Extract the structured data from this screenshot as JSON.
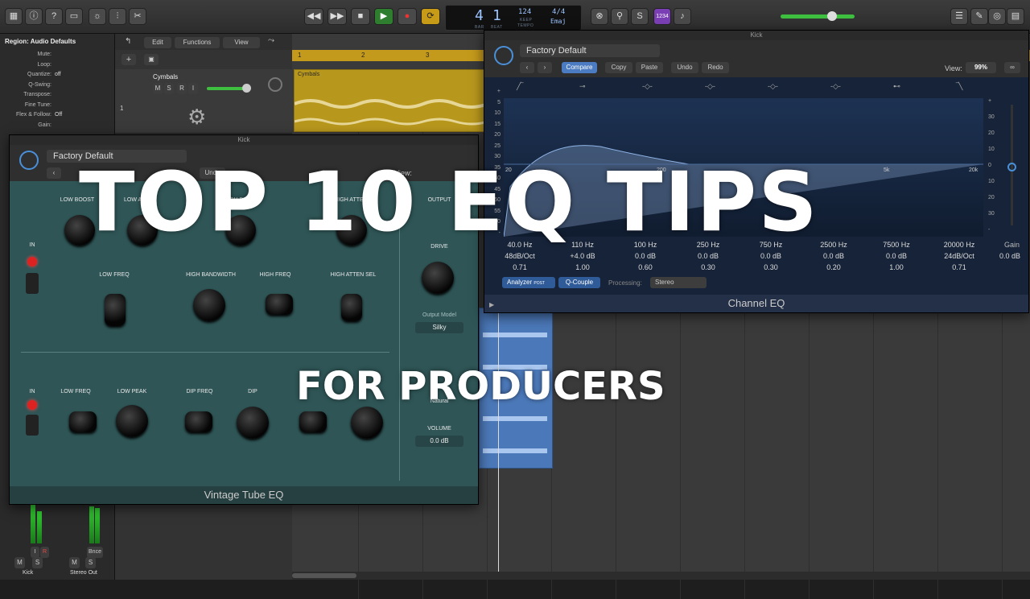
{
  "transport": {
    "bar": "4",
    "beat": "1",
    "bar_caption": "BAR",
    "beat_caption": "BEAT",
    "tempo": "124",
    "tempo_caption": "KEEP",
    "tempo_sub": "TEMPO",
    "signature": "4/4",
    "key": "Emaj",
    "count_in": "1234"
  },
  "inspector": {
    "region_title": "Region: Audio Defaults",
    "rows": [
      {
        "label": "Mute:",
        "value": ""
      },
      {
        "label": "Loop:",
        "value": ""
      },
      {
        "label": "Quantize:",
        "value": "off"
      },
      {
        "label": "Q-Swing:",
        "value": ""
      },
      {
        "label": "Transpose:",
        "value": ""
      },
      {
        "label": "Fine Tune:",
        "value": ""
      },
      {
        "label": "Flex & Follow:",
        "value": "Off"
      },
      {
        "label": "Gain:",
        "value": ""
      }
    ]
  },
  "edit_menu": {
    "edit": "Edit",
    "functions": "Functions",
    "view": "View"
  },
  "ruler": [
    "1",
    "2",
    "3"
  ],
  "track": {
    "name": "Cymbals",
    "number": "1",
    "m": "M",
    "s": "S",
    "r": "R",
    "i": "I",
    "region": "Cymbals"
  },
  "mixer": {
    "strip1": {
      "name": "Kick",
      "m": "M",
      "s": "S",
      "i": "I",
      "r": "R"
    },
    "strip2": {
      "name": "Stereo Out",
      "m": "M",
      "s": "S",
      "bnce": "Bnce"
    }
  },
  "vintage_eq": {
    "window_title": "Kick",
    "preset": "Factory Default",
    "undo": "Undo",
    "view": "View:",
    "name": "Vintage Tube EQ",
    "labels": {
      "low_boost": "LOW BOOST",
      "low_atten": "LOW ATTEN",
      "high_boost": "HIGH BOOST",
      "high_atten": "HIGH ATTEN",
      "in1": "IN",
      "in2": "IN",
      "low_freq": "LOW FREQ",
      "high_bandwidth": "HIGH BANDWIDTH",
      "high_freq": "HIGH FREQ",
      "high_atten_sel": "HIGH ATTEN SEL",
      "low_freq2": "LOW FREQ",
      "low_peak": "LOW PEAK",
      "dip_freq": "DIP FREQ",
      "dip": "DIP",
      "output": "OUTPUT",
      "drive": "DRIVE",
      "output_model": "Output Model",
      "output_model_value": "Silky",
      "natural": "Natural",
      "volume": "VOLUME",
      "volume_value": "0.0 dB"
    }
  },
  "channel_eq": {
    "window_title": "Kick",
    "preset": "Factory Default",
    "compare": "Compare",
    "copy": "Copy",
    "paste": "Paste",
    "undo": "Undo",
    "redo": "Redo",
    "view_label": "View:",
    "view_value": "99%",
    "name": "Channel EQ",
    "freq_labels": [
      "20",
      "200",
      "5k",
      "20k"
    ],
    "db_scale": [
      "+",
      "5",
      "10",
      "15",
      "20",
      "25",
      "30",
      "35",
      "40",
      "45",
      "50",
      "55",
      "60",
      "-"
    ],
    "right_scale": [
      "+",
      "30",
      "20",
      "10",
      "0",
      "10",
      "20",
      "30",
      "-"
    ],
    "bands": [
      {
        "freq": "40.0 Hz",
        "gain": "48dB/Oct",
        "q": "0.71"
      },
      {
        "freq": "110 Hz",
        "gain": "+4.0 dB",
        "q": "1.00"
      },
      {
        "freq": "100 Hz",
        "gain": "0.0 dB",
        "q": "0.60"
      },
      {
        "freq": "250 Hz",
        "gain": "0.0 dB",
        "q": "0.30"
      },
      {
        "freq": "750 Hz",
        "gain": "0.0 dB",
        "q": "0.30"
      },
      {
        "freq": "2500 Hz",
        "gain": "0.0 dB",
        "q": "0.20"
      },
      {
        "freq": "7500 Hz",
        "gain": "0.0 dB",
        "q": "1.00"
      },
      {
        "freq": "20000 Hz",
        "gain": "24dB/Oct",
        "q": "0.71"
      }
    ],
    "gain_label": "Gain",
    "gain_value": "0.0 dB",
    "analyzer": "Analyzer",
    "analyzer_post": "POST",
    "q_couple": "Q-Couple",
    "processing_label": "Processing:",
    "processing_value": "Stereo"
  },
  "overlay": {
    "headline": "TOP 10 EQ TIPS",
    "subline": "FOR PRODUCERS"
  }
}
